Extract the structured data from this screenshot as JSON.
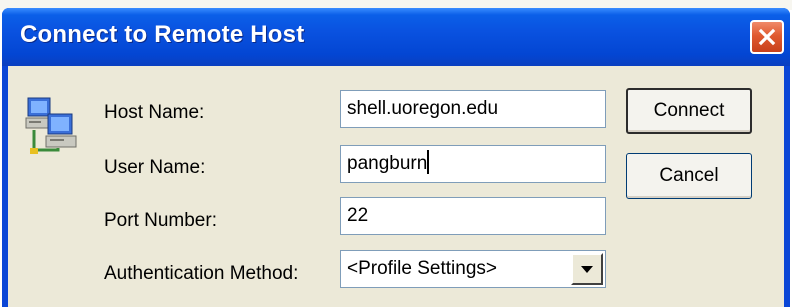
{
  "window": {
    "title": "Connect to Remote Host"
  },
  "form": {
    "host_label": "Host Name:",
    "host_value": "shell.uoregon.edu",
    "user_label": "User Name:",
    "user_value": "pangburn",
    "port_label": "Port Number:",
    "port_value": "22",
    "auth_label": "Authentication Method:",
    "auth_value": "<Profile Settings>"
  },
  "buttons": {
    "connect": "Connect",
    "cancel": "Cancel"
  },
  "icons": {
    "dialog_icon": "networked-computers-icon",
    "close": "close-icon",
    "dropdown": "chevron-down-icon"
  },
  "colors": {
    "titlebar": "#0a52e0",
    "close_button": "#e05a30",
    "client_background": "#ece9d8"
  }
}
